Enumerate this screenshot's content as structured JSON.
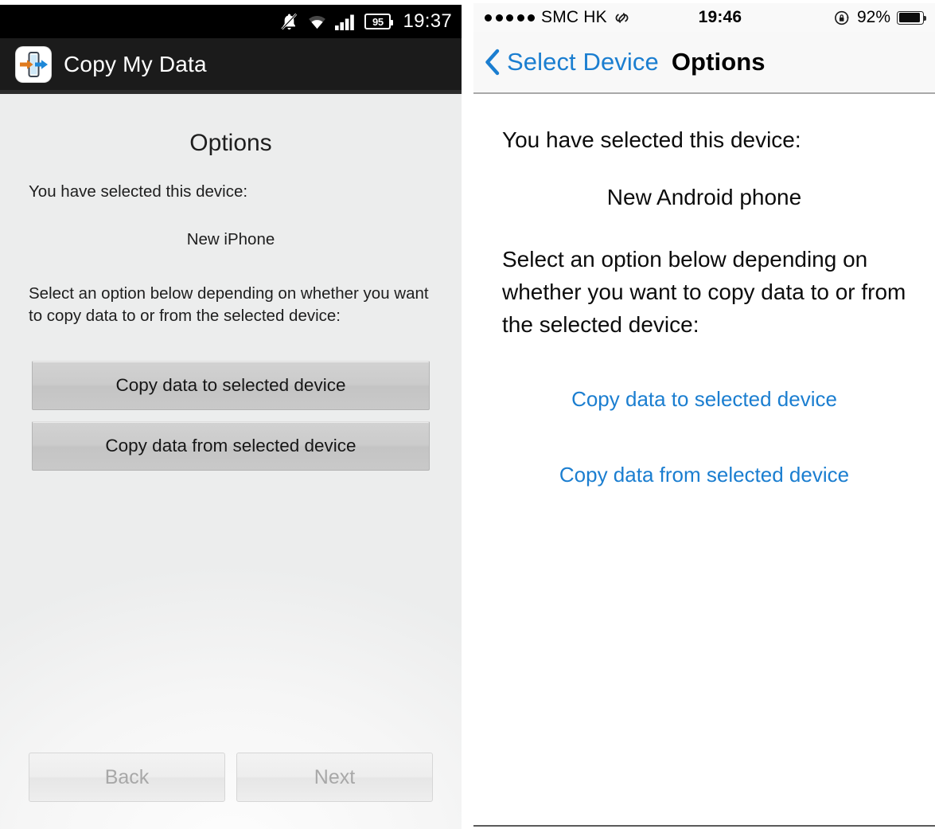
{
  "android": {
    "status_bar": {
      "silent_icon": "bell-muted-icon",
      "wifi_icon": "wifi-icon",
      "signal_icon": "signal-bars-icon",
      "battery_icon": "battery-icon",
      "battery_level": "95",
      "time": "19:37"
    },
    "action_bar": {
      "app_icon": "copy-my-data-app-icon",
      "app_title": "Copy My Data"
    },
    "content": {
      "heading": "Options",
      "selected_label": "You have selected this device:",
      "selected_device": "New iPhone",
      "instructions": "Select an option below depending on whether you want to copy data to or from the selected device:",
      "buttons": [
        {
          "label": "Copy data to selected device"
        },
        {
          "label": "Copy data from selected device"
        }
      ]
    },
    "footer": {
      "back_label": "Back",
      "next_label": "Next"
    }
  },
  "ios": {
    "status_bar": {
      "signal_icon": "signal-dots-icon",
      "carrier": "SMC HK",
      "hotspot_icon": "personal-hotspot-icon",
      "time": "19:46",
      "rotation_lock_icon": "rotation-lock-icon",
      "battery_percent": "92%",
      "battery_icon": "battery-icon"
    },
    "nav_bar": {
      "back_icon": "chevron-left-icon",
      "back_label": "Select Device",
      "title": "Options"
    },
    "content": {
      "selected_label": "You have selected this device:",
      "selected_device": "New Android phone",
      "instructions": "Select an option below depending on whether you want to copy data to or from the selected device:",
      "links": [
        {
          "label": "Copy data to selected device"
        },
        {
          "label": "Copy data from selected device"
        }
      ]
    }
  },
  "colors": {
    "ios_blue": "#1b7ed0",
    "android_bar": "#1b1b1b",
    "android_bg": "#eceded",
    "icon_orange": "#e07b1e",
    "icon_blue": "#1e88d8"
  }
}
